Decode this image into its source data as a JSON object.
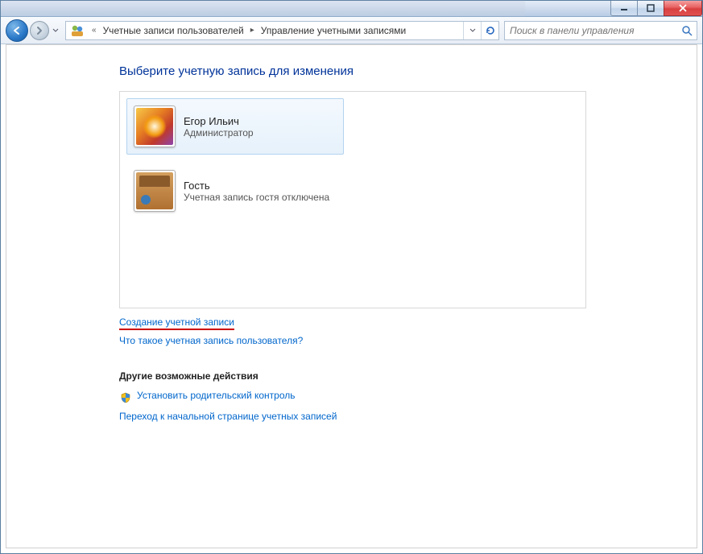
{
  "breadcrumb": {
    "level1": "Учетные записи пользователей",
    "level2": "Управление учетными записями"
  },
  "search": {
    "placeholder": "Поиск в панели управления"
  },
  "page": {
    "title": "Выберите учетную запись для изменения"
  },
  "accounts": [
    {
      "name": "Егор Ильич",
      "role": "Администратор",
      "selected": true,
      "avatar": "flower"
    },
    {
      "name": "Гость",
      "role": "Учетная запись гостя отключена",
      "selected": false,
      "avatar": "case"
    }
  ],
  "links": {
    "create": "Создание учетной записи",
    "what_is": "Что такое учетная запись пользователя?"
  },
  "other": {
    "title": "Другие возможные действия",
    "parental": "Установить родительский контроль",
    "home": "Переход к начальной странице учетных записей"
  }
}
